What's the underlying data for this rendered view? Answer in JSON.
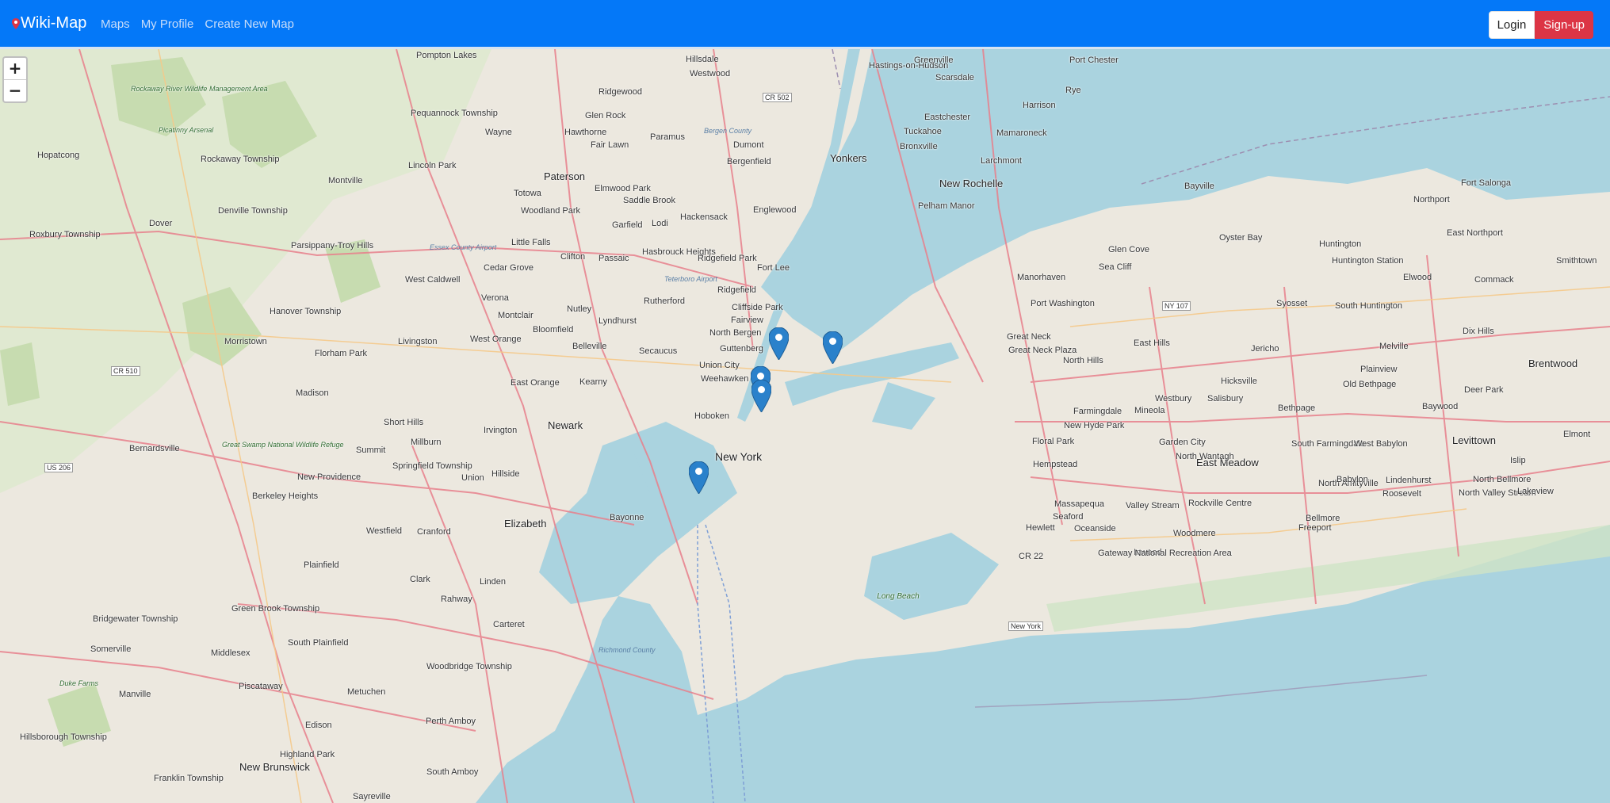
{
  "navbar": {
    "brand": "Wiki-Map",
    "links": [
      "Maps",
      "My Profile",
      "Create New Map"
    ],
    "login_label": "Login",
    "signup_label": "Sign-up"
  },
  "map": {
    "zoom_in": "+",
    "zoom_out": "−",
    "marker_count": 5,
    "labels": [
      "Pompton Lakes",
      "Hillsdale",
      "Westwood",
      "Hastings-on-Hudson",
      "Greenville",
      "Scarsdale",
      "Port Chester",
      "Rye",
      "Ridgewood",
      "CR 502",
      "Glen Rock",
      "Harrison",
      "Eastchester",
      "Tuckahoe",
      "Bronxville",
      "Mamaroneck",
      "Rockaway River Wildlife Management Area",
      "Picatinny Arsenal",
      "Pequannock Township",
      "Wayne",
      "Hawthorne",
      "Paramus",
      "Bergen County",
      "Dumont",
      "Fair Lawn",
      "Bergenfield",
      "Yonkers",
      "Larchmont",
      "New Rochelle",
      "Hopatcong",
      "Rockaway Township",
      "Lincoln Park",
      "Paterson",
      "Elmwood Park",
      "Saddle Brook",
      "Englewood",
      "Pelham Manor",
      "Montville",
      "Totowa",
      "Woodland Park",
      "Denville Township",
      "Garfield",
      "Lodi",
      "Hackensack",
      "Dover",
      "Roxbury Township",
      "Little Falls",
      "Parsippany-Troy Hills",
      "Essex County Airport",
      "Clifton",
      "Passaic",
      "Hasbrouck Heights",
      "Ridgefield Park",
      "Fort Lee",
      "Cedar Grove",
      "West Caldwell",
      "Teterboro Airport",
      "Ridgefield",
      "Verona",
      "Rutherford",
      "Cliffside Park",
      "Montclair",
      "Nutley",
      "Lyndhurst",
      "Fairview",
      "Hanover Township",
      "North Bergen",
      "Bloomfield",
      "Morristown",
      "Florham Park",
      "Livingston",
      "West Orange",
      "Belleville",
      "Secaucus",
      "Guttenberg",
      "CR 510",
      "Union City",
      "Weehawken",
      "East Orange",
      "Kearny",
      "Madison",
      "Hoboken",
      "Short Hills",
      "Newark",
      "Irvington",
      "Bernardsville",
      "Millburn",
      "Great Swamp National Wildlife Refuge",
      "Summit",
      "Springfield Township",
      "Hillside",
      "New York",
      "New Providence",
      "Union",
      "US 206",
      "Berkeley Heights",
      "Bayonne",
      "Elizabeth",
      "Westfield",
      "Cranford",
      "Plainfield",
      "Clark",
      "Linden",
      "Rahway",
      "Green Brook Township",
      "Bridgewater Township",
      "Carteret",
      "South Plainfield",
      "Somerville",
      "Middlesex",
      "Richmond County",
      "Piscataway",
      "Woodbridge Township",
      "Duke Farms",
      "Manville",
      "Metuchen",
      "Edison",
      "Perth Amboy",
      "Hillsborough Township",
      "Highland Park",
      "New Brunswick",
      "Franklin Township",
      "South Amboy",
      "Sayreville",
      "Bayville",
      "Oyster Bay",
      "Fort Salonga",
      "Northport",
      "East Northport",
      "Huntington",
      "Huntington Station",
      "Smithtown",
      "Elwood",
      "Commack",
      "Glen Cove",
      "Sea Cliff",
      "Manorhaven",
      "Port Washington",
      "NY 107",
      "Syosset",
      "South Huntington",
      "Dix Hills",
      "Brentwood",
      "Melville",
      "Jericho",
      "Great Neck",
      "Great Neck Plaza",
      "East Hills",
      "North Hills",
      "Plainview",
      "Old Bethpage",
      "Deer Park",
      "Hicksville",
      "Westbury",
      "Salisbury",
      "Bethpage",
      "Baywood",
      "Mineola",
      "Farmingdale",
      "New Hyde Park",
      "Floral Park",
      "Garden City",
      "Levittown",
      "South Farmingdale",
      "West Babylon",
      "Islip",
      "Elmont",
      "Hempstead",
      "East Meadow",
      "North Wantagh",
      "North Amityville",
      "Babylon",
      "Lindenhurst",
      "North Bellmore",
      "North Valley Stream",
      "Lakeview",
      "Roosevelt",
      "Massapequa",
      "Seaford",
      "Valley Stream",
      "Rockville Centre",
      "Freeport",
      "Bellmore",
      "Hewlett",
      "Oceanside",
      "Woodmere",
      "Inwood",
      "Gateway National Recreation Area",
      "CR 22",
      "Long Beach",
      "New York"
    ]
  }
}
